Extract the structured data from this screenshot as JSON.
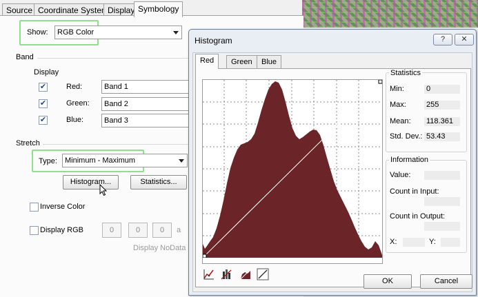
{
  "tabs": [
    {
      "label": "Source"
    },
    {
      "label": "Coordinate System"
    },
    {
      "label": "Display"
    },
    {
      "label": "Symbology"
    }
  ],
  "symbology": {
    "show_label": "Show:",
    "show_value": "RGB Color",
    "band_title": "Band",
    "display_label": "Display",
    "bands": [
      {
        "label": "Red:",
        "value": "Band 1",
        "checked": true
      },
      {
        "label": "Green:",
        "value": "Band 2",
        "checked": true
      },
      {
        "label": "Blue:",
        "value": "Band 3",
        "checked": true
      }
    ],
    "stretch_title": "Stretch",
    "type_label": "Type:",
    "type_value": "Minimum - Maximum",
    "histogram_button": "Histogram...",
    "statistics_button": "Statistics...",
    "inverse_color_label": "Inverse Color",
    "display_rgb_label": "Display RGB",
    "rgb_values": [
      "0",
      "0",
      "0"
    ],
    "rgb_suffix": "a",
    "nodata_label": "Display NoData a"
  },
  "histogram": {
    "title": "Histogram",
    "help_button": "?",
    "close_button": "✕",
    "tabs": [
      {
        "label": "Red"
      },
      {
        "label": "Green"
      },
      {
        "label": "Blue"
      }
    ],
    "statistics": {
      "title": "Statistics",
      "min_label": "Min:",
      "min_value": "0",
      "max_label": "Max:",
      "max_value": "255",
      "mean_label": "Mean:",
      "mean_value": "118.361",
      "std_label": "Std. Dev.:",
      "std_value": "53.43"
    },
    "information": {
      "title": "Information",
      "value_label": "Value:",
      "count_input_label": "Count in Input:",
      "count_output_label": "Count in Output:",
      "x_label": "X:",
      "y_label": "Y:"
    },
    "ok_button": "OK",
    "cancel_button": "Cancel",
    "fill_color": "#6b2427",
    "tool_icons": [
      "scatter-stretch-icon",
      "histogram-equalize-icon",
      "histogram-specify-icon",
      "linear-stretch-icon"
    ]
  }
}
